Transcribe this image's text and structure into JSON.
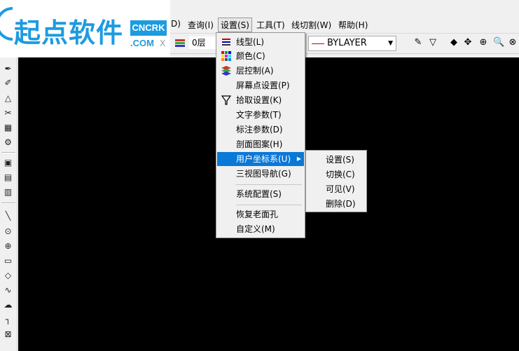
{
  "logo": {
    "brand": "起点软件",
    "badge_top": "CNCRK",
    "badge_bottom": ".COM",
    "corner_char": "X"
  },
  "menubar": {
    "partial_item": "D)",
    "items": [
      "查询(I)",
      "设置(S)",
      "工具(T)",
      "线切割(W)",
      "帮助(H)"
    ]
  },
  "toolbar": {
    "layer_value": "0层",
    "linetype_value": "BYLAYER"
  },
  "settings_menu": {
    "items": [
      {
        "label": "线型(L)",
        "icon": "linetype-icon"
      },
      {
        "label": "颜色(C)",
        "icon": "color-icon"
      },
      {
        "label": "层控制(A)",
        "icon": "layer-icon"
      },
      {
        "label": "屏幕点设置(P)",
        "icon": ""
      },
      {
        "label": "拾取设置(K)",
        "icon": "filter-icon"
      },
      {
        "label": "文字参数(T)",
        "icon": ""
      },
      {
        "label": "标注参数(D)",
        "icon": ""
      },
      {
        "label": "剖面图案(H)",
        "icon": ""
      },
      {
        "label": "用户坐标系(U)",
        "icon": ""
      },
      {
        "label": "三视图导航(G)",
        "icon": ""
      },
      {
        "label": "系统配置(S)",
        "icon": ""
      },
      {
        "label": "恢复老面孔",
        "icon": ""
      },
      {
        "label": "自定义(M)",
        "icon": ""
      }
    ],
    "highlighted": "用户坐标系(U)"
  },
  "ucs_submenu": {
    "items": [
      "设置(S)",
      "切换(C)",
      "可见(V)",
      "删除(D)"
    ]
  },
  "colors": {
    "highlight": "#0a78d7",
    "canvas": "#000000",
    "brand": "#1d9be0"
  }
}
